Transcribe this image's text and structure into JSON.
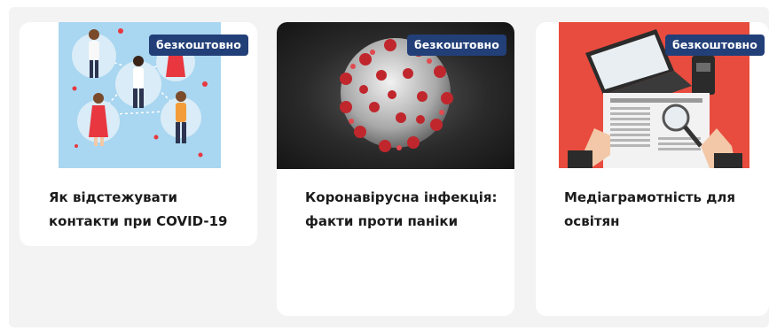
{
  "courses": [
    {
      "title": "Як відстежувати контакти при COVID-19",
      "badge": "безкоштовно",
      "image_icon": "contact-tracing-illustration"
    },
    {
      "title": "Коронавірусна інфекція: факти проти паніки",
      "badge": "безкоштовно",
      "image_icon": "coronavirus-illustration"
    },
    {
      "title": "Медіаграмотність для освітян",
      "badge": "безкоштовно",
      "image_icon": "newspaper-laptop-illustration"
    }
  ],
  "colors": {
    "badge_bg": "#223f78",
    "panel_bg": "#f3f3f4",
    "card_bg": "#ffffff"
  }
}
